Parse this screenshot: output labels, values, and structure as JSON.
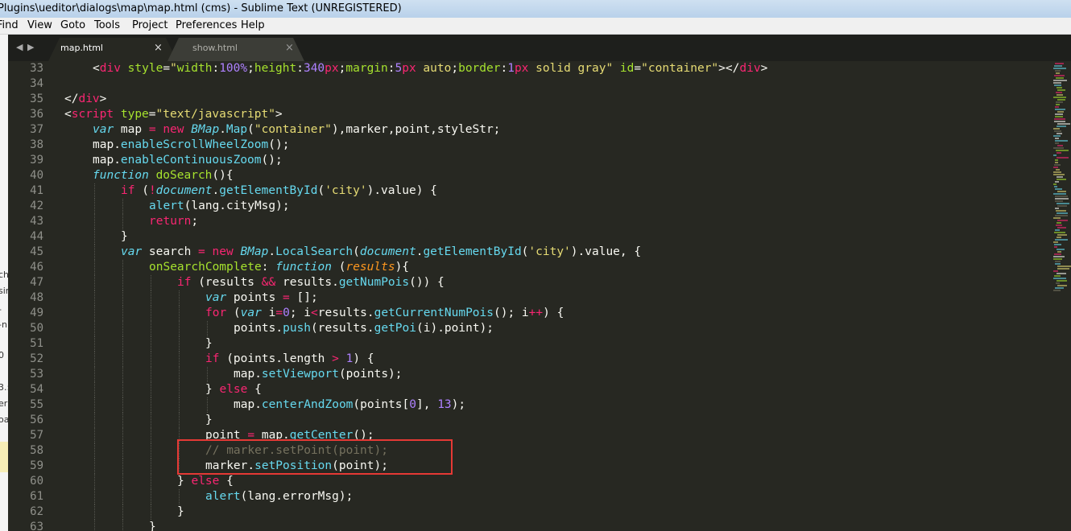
{
  "window": {
    "title": "Plugins\\ueditor\\dialogs\\map\\map.html (cms) - Sublime Text (UNREGISTERED)"
  },
  "menu": [
    "Find",
    "View",
    "Goto",
    "Tools",
    "Project",
    "Preferences",
    "Help"
  ],
  "left_strip_fragments": [
    "ch",
    "sir",
    "-",
    "-n",
    "0",
    "3.:",
    "er",
    "oa"
  ],
  "tabs": [
    {
      "label": "map.html",
      "active": true,
      "close": "×"
    },
    {
      "label": "show.html",
      "active": false,
      "close": "×"
    }
  ],
  "nav": {
    "back": "◀",
    "forward": "▶"
  },
  "colors": {
    "editor_bg": "#272822",
    "tag": "#f92672",
    "attr": "#a6e22e",
    "string": "#e6db74",
    "number": "#ae81ff",
    "keyword": "#66d9ef",
    "param": "#fd971f",
    "comment": "#75715e",
    "highlight_box": "#e53935"
  },
  "code": [
    {
      "num": "33",
      "indent": 1,
      "tokens": [
        [
          "w",
          "<"
        ],
        [
          "t",
          "div"
        ],
        [
          "w",
          " "
        ],
        [
          "a",
          "style"
        ],
        [
          "w",
          "="
        ],
        [
          "s",
          "\""
        ],
        [
          "a",
          "width"
        ],
        [
          "w",
          ":"
        ],
        [
          "n",
          "100%"
        ],
        [
          "w",
          ";"
        ],
        [
          "a",
          "height"
        ],
        [
          "w",
          ":"
        ],
        [
          "n",
          "340"
        ],
        [
          "t",
          "px"
        ],
        [
          "w",
          ";"
        ],
        [
          "a",
          "margin"
        ],
        [
          "w",
          ":"
        ],
        [
          "n",
          "5"
        ],
        [
          "t",
          "px"
        ],
        [
          "s",
          " auto"
        ],
        [
          "w",
          ";"
        ],
        [
          "a",
          "border"
        ],
        [
          "w",
          ":"
        ],
        [
          "n",
          "1"
        ],
        [
          "t",
          "px"
        ],
        [
          "s",
          " solid gray\""
        ],
        [
          "w",
          " "
        ],
        [
          "a",
          "id"
        ],
        [
          "w",
          "="
        ],
        [
          "s",
          "\"container\""
        ],
        [
          "w",
          "></"
        ],
        [
          "t",
          "div"
        ],
        [
          "w",
          ">"
        ]
      ]
    },
    {
      "num": "34",
      "indent": 0,
      "tokens": []
    },
    {
      "num": "35",
      "indent": 0,
      "tokens": [
        [
          "w",
          "</"
        ],
        [
          "t",
          "div"
        ],
        [
          "w",
          ">"
        ]
      ]
    },
    {
      "num": "36",
      "indent": 0,
      "tokens": [
        [
          "w",
          "<"
        ],
        [
          "t",
          "script"
        ],
        [
          "w",
          " "
        ],
        [
          "a",
          "type"
        ],
        [
          "w",
          "="
        ],
        [
          "s",
          "\"text/javascript\""
        ],
        [
          "w",
          ">"
        ]
      ]
    },
    {
      "num": "37",
      "indent": 1,
      "tokens": [
        [
          "k",
          "var"
        ],
        [
          "w",
          " map "
        ],
        [
          "t",
          "="
        ],
        [
          "w",
          " "
        ],
        [
          "t",
          "new"
        ],
        [
          "w",
          " "
        ],
        [
          "k",
          "BMap"
        ],
        [
          "w",
          "."
        ],
        [
          "f",
          "Map"
        ],
        [
          "w",
          "("
        ],
        [
          "s",
          "\"container\""
        ],
        [
          "w",
          "),marker,point,styleStr;"
        ]
      ]
    },
    {
      "num": "38",
      "indent": 1,
      "tokens": [
        [
          "w",
          "map."
        ],
        [
          "f",
          "enableScrollWheelZoom"
        ],
        [
          "w",
          "();"
        ]
      ]
    },
    {
      "num": "39",
      "indent": 1,
      "tokens": [
        [
          "w",
          "map."
        ],
        [
          "f",
          "enableContinuousZoom"
        ],
        [
          "w",
          "();"
        ]
      ]
    },
    {
      "num": "40",
      "indent": 1,
      "tokens": [
        [
          "k",
          "function"
        ],
        [
          "w",
          " "
        ],
        [
          "a",
          "doSearch"
        ],
        [
          "w",
          "(){"
        ]
      ]
    },
    {
      "num": "41",
      "indent": 2,
      "tokens": [
        [
          "t",
          "if"
        ],
        [
          "w",
          " ("
        ],
        [
          "t",
          "!"
        ],
        [
          "k",
          "document"
        ],
        [
          "w",
          "."
        ],
        [
          "f",
          "getElementById"
        ],
        [
          "w",
          "("
        ],
        [
          "s",
          "'city'"
        ],
        [
          "w",
          ").value) {"
        ]
      ]
    },
    {
      "num": "42",
      "indent": 3,
      "tokens": [
        [
          "f",
          "alert"
        ],
        [
          "w",
          "(lang.cityMsg);"
        ]
      ]
    },
    {
      "num": "43",
      "indent": 3,
      "tokens": [
        [
          "t",
          "return"
        ],
        [
          "w",
          ";"
        ]
      ]
    },
    {
      "num": "44",
      "indent": 2,
      "tokens": [
        [
          "w",
          "}"
        ]
      ]
    },
    {
      "num": "45",
      "indent": 2,
      "tokens": [
        [
          "k",
          "var"
        ],
        [
          "w",
          " search "
        ],
        [
          "t",
          "="
        ],
        [
          "w",
          " "
        ],
        [
          "t",
          "new"
        ],
        [
          "w",
          " "
        ],
        [
          "k",
          "BMap"
        ],
        [
          "w",
          "."
        ],
        [
          "f",
          "LocalSearch"
        ],
        [
          "w",
          "("
        ],
        [
          "k",
          "document"
        ],
        [
          "w",
          "."
        ],
        [
          "f",
          "getElementById"
        ],
        [
          "w",
          "("
        ],
        [
          "s",
          "'city'"
        ],
        [
          "w",
          ").value, {"
        ]
      ]
    },
    {
      "num": "46",
      "indent": 3,
      "tokens": [
        [
          "a",
          "onSearchComplete"
        ],
        [
          "w",
          ": "
        ],
        [
          "k",
          "function"
        ],
        [
          "w",
          " ("
        ],
        [
          "p",
          "results"
        ],
        [
          "w",
          "){"
        ]
      ]
    },
    {
      "num": "47",
      "indent": 4,
      "tokens": [
        [
          "t",
          "if"
        ],
        [
          "w",
          " (results "
        ],
        [
          "t",
          "&&"
        ],
        [
          "w",
          " results."
        ],
        [
          "f",
          "getNumPois"
        ],
        [
          "w",
          "()) {"
        ]
      ]
    },
    {
      "num": "48",
      "indent": 5,
      "tokens": [
        [
          "k",
          "var"
        ],
        [
          "w",
          " points "
        ],
        [
          "t",
          "="
        ],
        [
          "w",
          " [];"
        ]
      ]
    },
    {
      "num": "49",
      "indent": 5,
      "tokens": [
        [
          "t",
          "for"
        ],
        [
          "w",
          " ("
        ],
        [
          "k",
          "var"
        ],
        [
          "w",
          " i"
        ],
        [
          "t",
          "="
        ],
        [
          "n",
          "0"
        ],
        [
          "w",
          "; i"
        ],
        [
          "t",
          "<"
        ],
        [
          "w",
          "results."
        ],
        [
          "f",
          "getCurrentNumPois"
        ],
        [
          "w",
          "(); i"
        ],
        [
          "t",
          "++"
        ],
        [
          "w",
          ") {"
        ]
      ]
    },
    {
      "num": "50",
      "indent": 6,
      "tokens": [
        [
          "w",
          "points."
        ],
        [
          "f",
          "push"
        ],
        [
          "w",
          "(results."
        ],
        [
          "f",
          "getPoi"
        ],
        [
          "w",
          "(i).point);"
        ]
      ]
    },
    {
      "num": "51",
      "indent": 5,
      "tokens": [
        [
          "w",
          "}"
        ]
      ]
    },
    {
      "num": "52",
      "indent": 5,
      "tokens": [
        [
          "t",
          "if"
        ],
        [
          "w",
          " (points.length "
        ],
        [
          "t",
          ">"
        ],
        [
          "w",
          " "
        ],
        [
          "n",
          "1"
        ],
        [
          "w",
          ") {"
        ]
      ]
    },
    {
      "num": "53",
      "indent": 6,
      "tokens": [
        [
          "w",
          "map."
        ],
        [
          "f",
          "setViewport"
        ],
        [
          "w",
          "(points);"
        ]
      ]
    },
    {
      "num": "54",
      "indent": 5,
      "tokens": [
        [
          "w",
          "} "
        ],
        [
          "t",
          "else"
        ],
        [
          "w",
          " {"
        ]
      ]
    },
    {
      "num": "55",
      "indent": 6,
      "tokens": [
        [
          "w",
          "map."
        ],
        [
          "f",
          "centerAndZoom"
        ],
        [
          "w",
          "(points["
        ],
        [
          "n",
          "0"
        ],
        [
          "w",
          "], "
        ],
        [
          "n",
          "13"
        ],
        [
          "w",
          ");"
        ]
      ]
    },
    {
      "num": "56",
      "indent": 5,
      "tokens": [
        [
          "w",
          "}"
        ]
      ]
    },
    {
      "num": "57",
      "indent": 5,
      "tokens": [
        [
          "w",
          "point "
        ],
        [
          "t",
          "="
        ],
        [
          "w",
          " map."
        ],
        [
          "f",
          "getCenter"
        ],
        [
          "w",
          "();"
        ]
      ]
    },
    {
      "num": "58",
      "indent": 5,
      "tokens": [
        [
          "c",
          "// marker.setPoint(point);"
        ]
      ]
    },
    {
      "num": "59",
      "indent": 5,
      "tokens": [
        [
          "w",
          "marker."
        ],
        [
          "f",
          "setPosition"
        ],
        [
          "w",
          "(point);"
        ]
      ]
    },
    {
      "num": "60",
      "indent": 4,
      "tokens": [
        [
          "w",
          "} "
        ],
        [
          "t",
          "else"
        ],
        [
          "w",
          " {"
        ]
      ]
    },
    {
      "num": "61",
      "indent": 5,
      "tokens": [
        [
          "f",
          "alert"
        ],
        [
          "w",
          "(lang.errorMsg);"
        ]
      ]
    },
    {
      "num": "62",
      "indent": 4,
      "tokens": [
        [
          "w",
          "}"
        ]
      ]
    },
    {
      "num": "63",
      "indent": 3,
      "tokens": [
        [
          "w",
          "}"
        ]
      ]
    }
  ]
}
